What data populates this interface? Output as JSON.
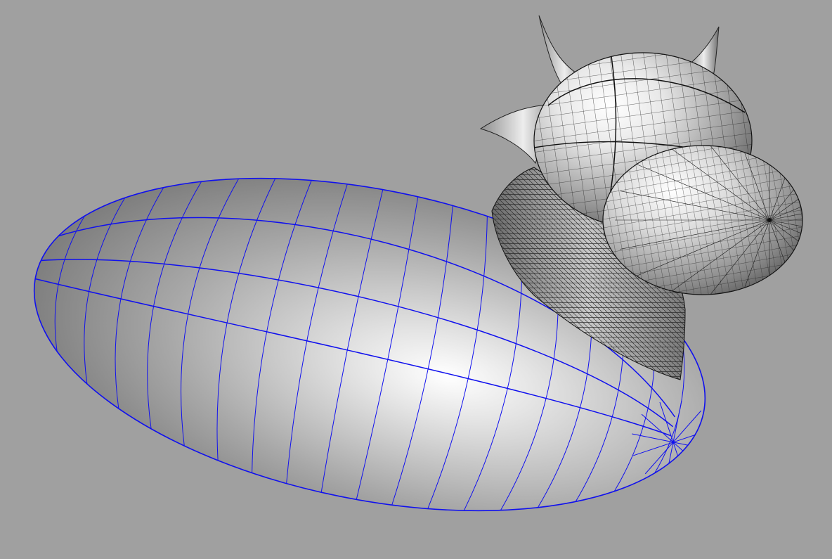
{
  "viewport": {
    "view": "perspective",
    "display_mode": "shaded",
    "background_color": "#a0a0a0"
  },
  "model": {
    "selected_object": "body",
    "objects": [
      {
        "name": "body",
        "shape": "ellipsoid",
        "selected": true,
        "isocurve_color": "#1010ee",
        "latitude_lines": 18,
        "meridian_lines": 4
      },
      {
        "name": "neck",
        "shape": "lofted surface",
        "selected": false,
        "isocurve_color": "#111111"
      },
      {
        "name": "head",
        "shape": "sphere",
        "selected": false,
        "isocurve_color": "#111111"
      },
      {
        "name": "beak",
        "shape": "ellipsoid",
        "selected": false,
        "isocurve_color": "#111111"
      },
      {
        "name": "left-horn",
        "shape": "cone",
        "selected": false
      },
      {
        "name": "right-horn",
        "shape": "cone",
        "selected": false
      },
      {
        "name": "crest",
        "shape": "fin",
        "selected": false
      }
    ],
    "surface_color": "#b4b4b4",
    "highlight_color": "#ffffff"
  }
}
